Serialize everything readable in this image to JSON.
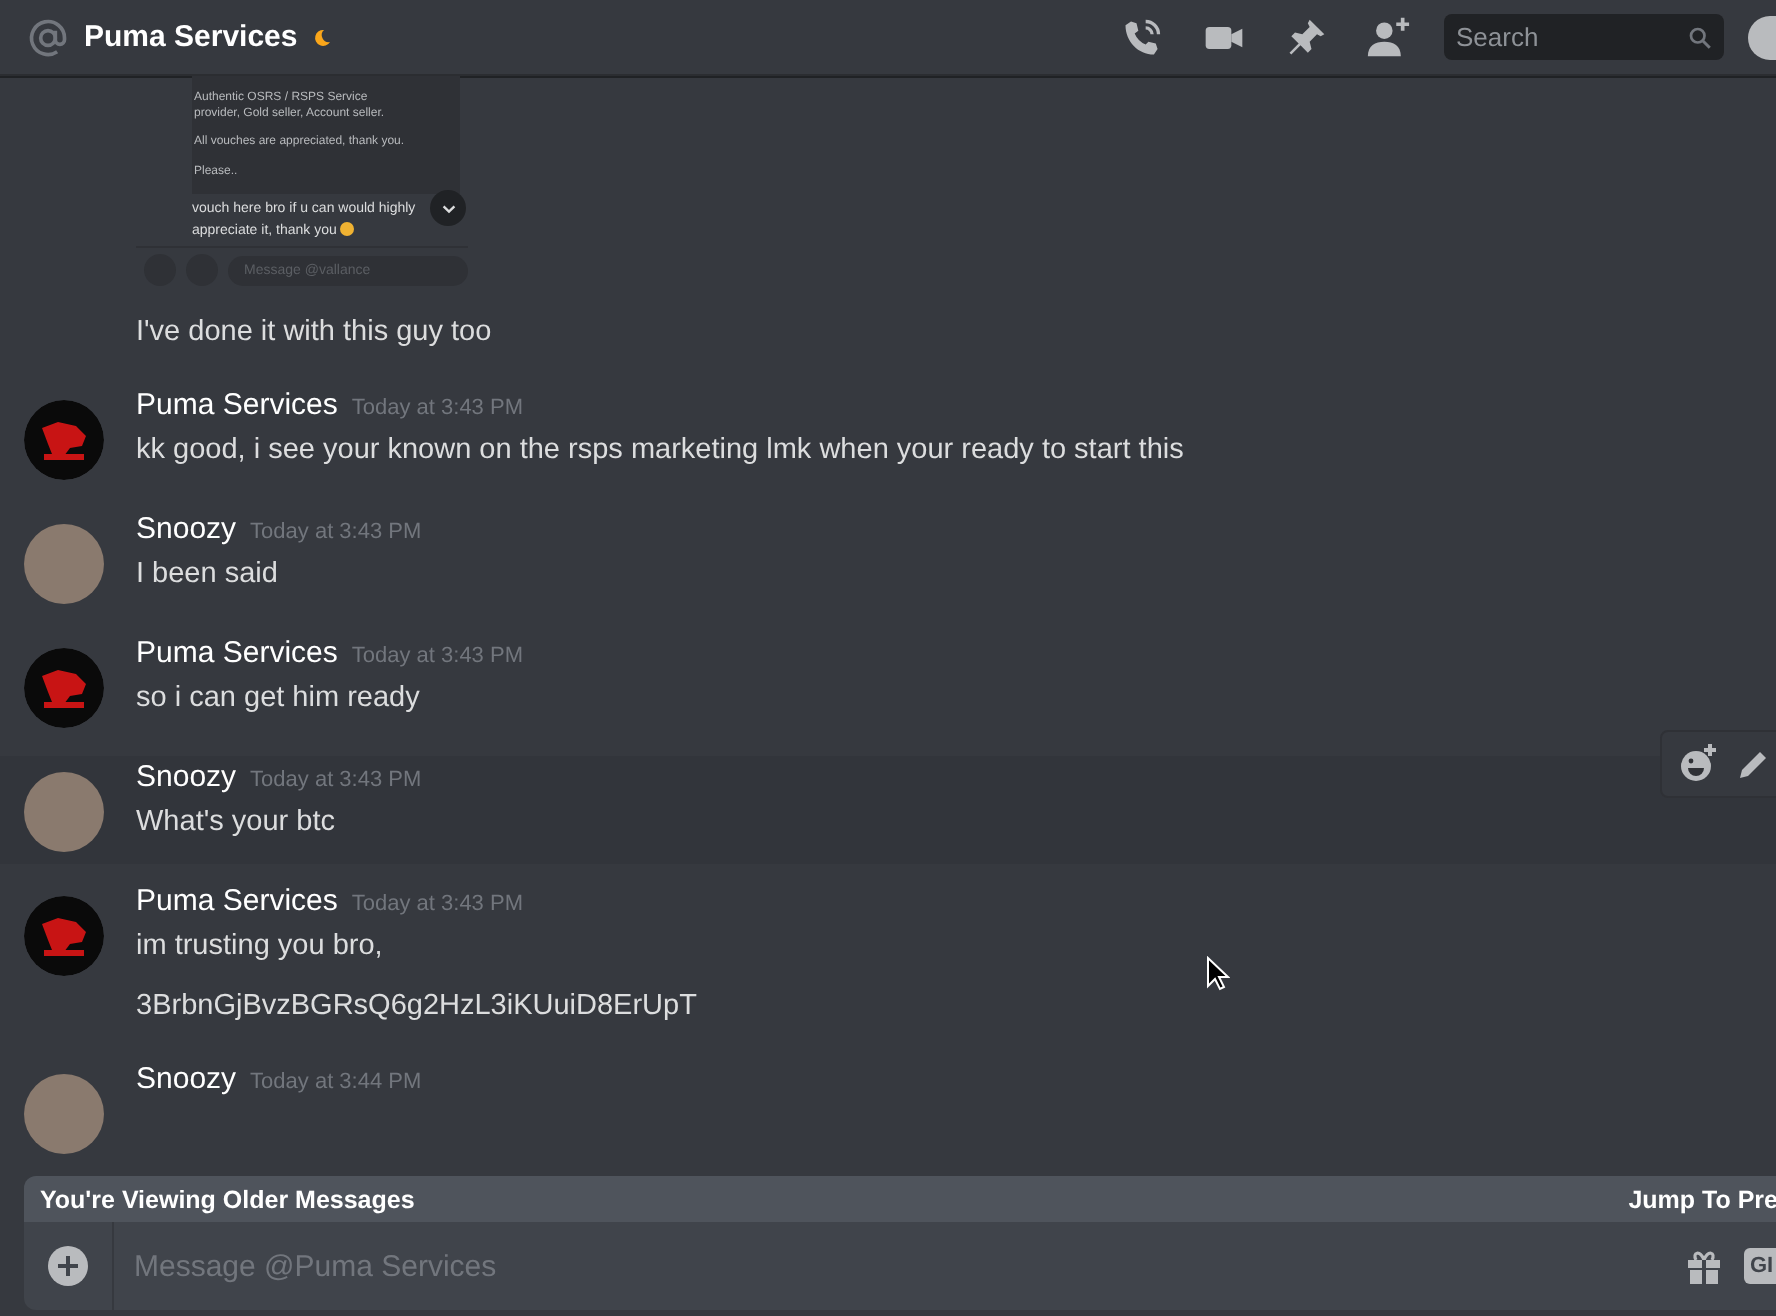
{
  "header": {
    "title": "Puma Services",
    "idle": true,
    "search": {
      "placeholder": "Search"
    }
  },
  "embedded_screenshot": {
    "lines": [
      "Authentic OSRS / RSPS Service provider, Gold seller, Account seller.",
      "All vouches are appreciated, thank you.",
      "Please.."
    ],
    "message": "vouch here bro if u can would highly appreciate it, thank you",
    "composer": {
      "placeholder": "Message @vallance"
    }
  },
  "messages": [
    {
      "kind": "continuation",
      "lines": [
        "I've done it with this guy too"
      ],
      "hovered": false
    },
    {
      "kind": "logo_avatar",
      "author": "Puma Services",
      "time": "Today at 3:43 PM",
      "lines": [
        "kk good, i see your known on the rsps marketing  lmk when your ready to start this"
      ],
      "hovered": false
    },
    {
      "kind": "photo_avatar",
      "author": "Snoozy",
      "time": "Today at 3:43 PM",
      "lines": [
        "I been said"
      ],
      "hovered": false
    },
    {
      "kind": "logo_avatar",
      "author": "Puma Services",
      "time": "Today at 3:43 PM",
      "lines": [
        "so i can get him ready"
      ],
      "hovered": false
    },
    {
      "kind": "photo_avatar",
      "author": "Snoozy",
      "time": "Today at 3:43 PM",
      "lines": [
        "What's your btc"
      ],
      "hovered": true
    },
    {
      "kind": "logo_avatar",
      "author": "Puma Services",
      "time": "Today at 3:43 PM",
      "lines": [
        "im trusting you bro,",
        "3BrbnGjBvzBGRsQ6g2HzL3iKUuiD8ErUpT"
      ],
      "hovered": false
    },
    {
      "kind": "photo_avatar",
      "author": "Snoozy",
      "time": "Today at 3:44 PM",
      "hovered": false
    }
  ],
  "older_banner": {
    "text": "You're Viewing Older Messages",
    "jump": "Jump To Pre"
  },
  "composer": {
    "placeholder": "Message @Puma Services",
    "gif": "GI"
  }
}
